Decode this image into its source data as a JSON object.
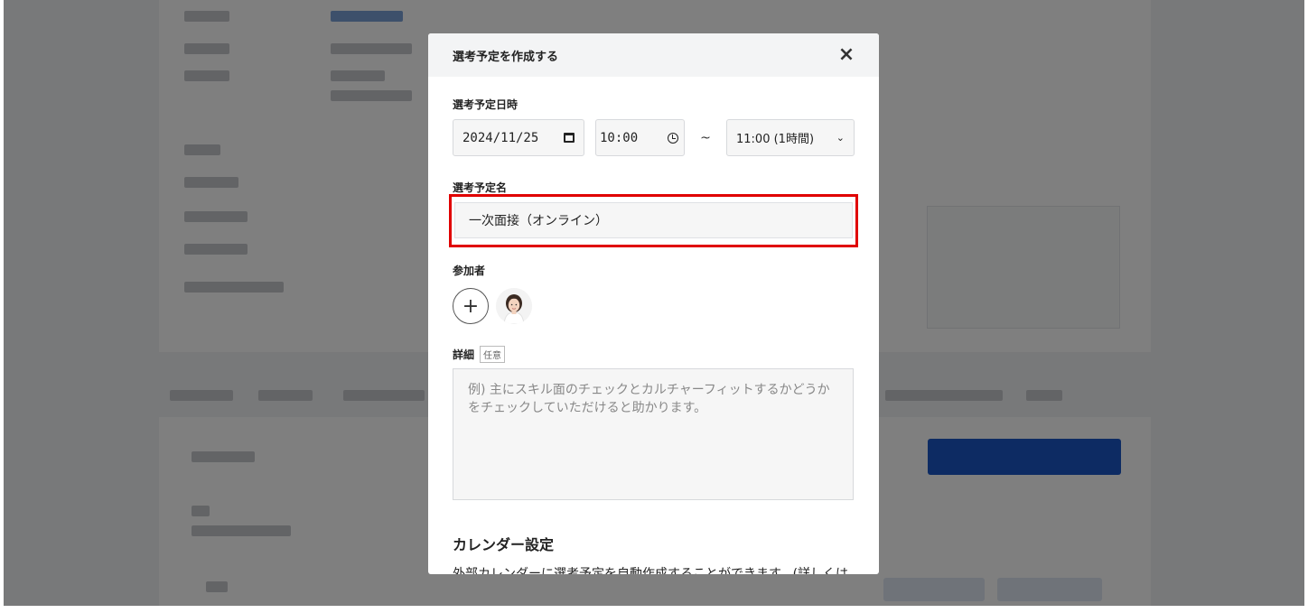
{
  "modal": {
    "title": "選考予定を作成する",
    "close_icon": "×",
    "schedule": {
      "label": "選考予定日時",
      "date": "2024/11/25",
      "start_time": "10:00",
      "separator": "~",
      "end_time": "11:00 (1時間)"
    },
    "name": {
      "label": "選考予定名",
      "value": "一次面接（オンライン）"
    },
    "participants": {
      "label": "参加者",
      "add_icon": "+"
    },
    "detail": {
      "label": "詳細",
      "optional_badge": "任意",
      "placeholder": "例) 主にスキル面のチェックとカルチャーフィットするかどうかをチェックしていただけると助かります。"
    },
    "calendar": {
      "title": "カレンダー設定",
      "description": "外部カレンダーに選考予定を自動作成することができます。(詳しくは"
    }
  },
  "colors": {
    "highlight": "#e00000",
    "overlay": "rgba(0,0,0,0.5)",
    "primary_bg_button": "#1a56c6"
  }
}
